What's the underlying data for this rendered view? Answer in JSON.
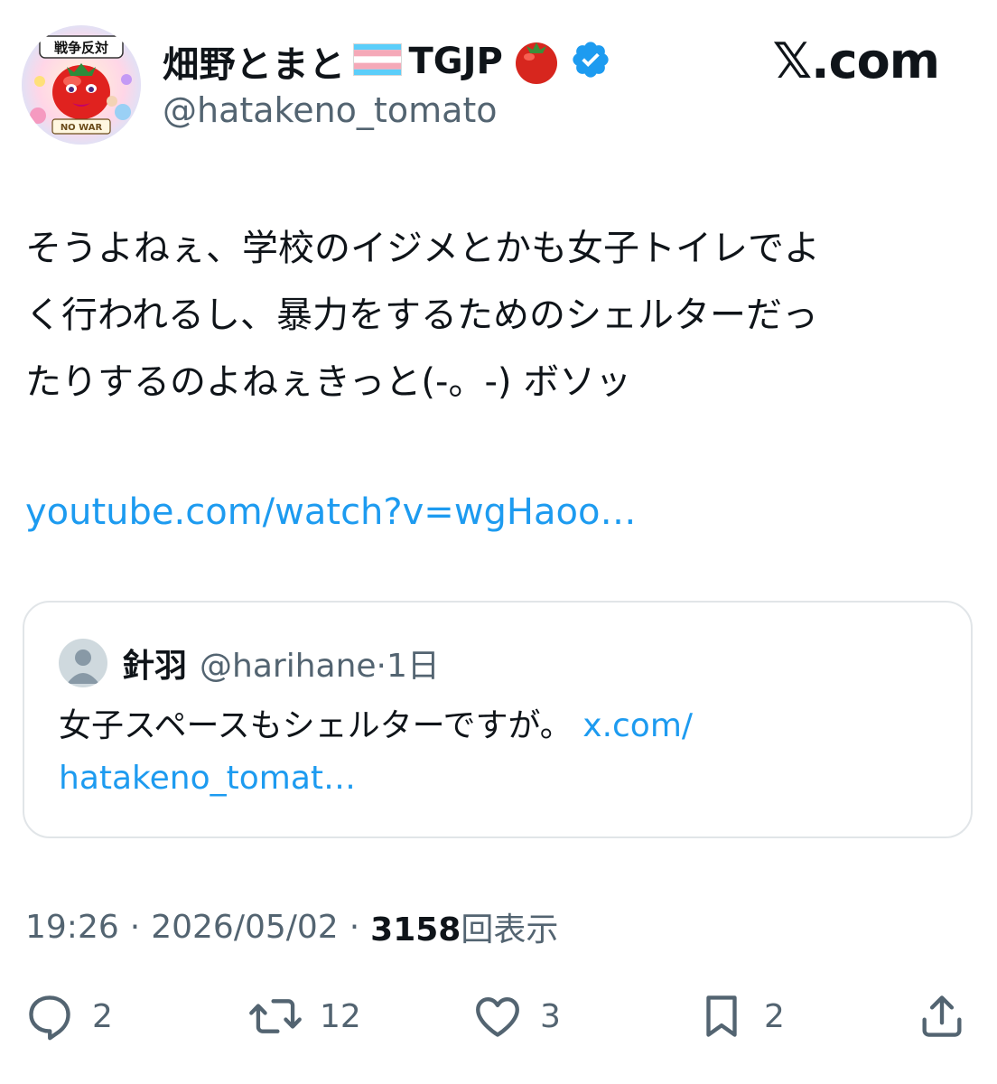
{
  "author": {
    "name": "畑野とまと",
    "flag_icon": "transgender-flag-icon",
    "tag": "TGJP",
    "tag_icon": "tomato-icon",
    "verified_icon": "verified-badge-icon",
    "handle": "@hatakeno_tomato",
    "avatar_texts": {
      "banner": "戦争反対",
      "ribbon": "NO WAR"
    }
  },
  "brand": "𝕏.com",
  "tweet": {
    "lines": [
      "そうよねぇ、学校のイジメとかも女子トイレでよ",
      "く行われるし、暴力をするためのシェルターだっ",
      "たりするのよねぇきっと(-。-) ボソッ"
    ],
    "link": "youtube.com/watch?v=wgHaoo…"
  },
  "quote": {
    "name": "針羽",
    "handle": "@harihane",
    "age": "1日",
    "text_line1": "女子スペースもシェルターですが。",
    "link_line1": "x.com/",
    "link_line2": "hatakeno_tomat…"
  },
  "meta": {
    "time": "19:26",
    "date": "2026/05/02",
    "separator": "·",
    "views": "3158",
    "views_label": "回表示"
  },
  "actions": {
    "reply_count": "2",
    "repost_count": "12",
    "like_count": "3",
    "bookmark_count": "2"
  },
  "colors": {
    "text": "#0f1419",
    "secondary": "#536471",
    "link": "#1d9bf0",
    "verified": "#1d9bf0",
    "border": "#e1e5e8"
  }
}
